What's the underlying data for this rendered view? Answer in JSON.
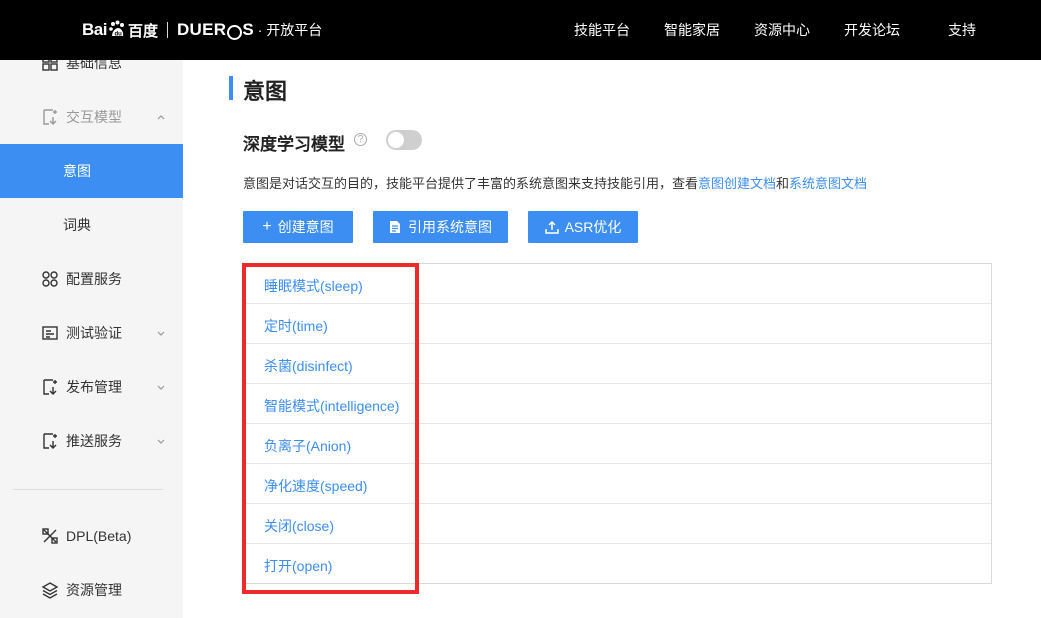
{
  "header": {
    "logo_baidu": "Bai",
    "logo_baidu_cn": "百度",
    "logo_duer": "DUER",
    "logo_os_s": "S",
    "logo_platform": "· 开放平台",
    "nav": [
      "技能平台",
      "智能家居",
      "资源中心",
      "开发论坛",
      "支持"
    ]
  },
  "sidebar": {
    "items": [
      {
        "label": "基础信息",
        "icon": "grid-icon"
      },
      {
        "label": "交互模型",
        "icon": "interaction-icon"
      },
      {
        "label": "意图"
      },
      {
        "label": "词典"
      },
      {
        "label": "配置服务",
        "icon": "config-icon"
      },
      {
        "label": "测试验证",
        "icon": "test-icon"
      },
      {
        "label": "发布管理",
        "icon": "publish-icon"
      },
      {
        "label": "推送服务",
        "icon": "push-icon"
      },
      {
        "label": "DPL(Beta)",
        "icon": "dpl-icon"
      },
      {
        "label": "资源管理",
        "icon": "layers-icon"
      }
    ]
  },
  "main": {
    "title": "意图",
    "model_label": "深度学习模型",
    "model_enabled": false,
    "help": "?",
    "description": "意图是对话交互的目的，技能平台提供了丰富的系统意图来支持技能引用，查看",
    "link1": "意图创建文档",
    "link_and": "和",
    "link2": "系统意图文档",
    "buttons": {
      "create": "创建意图",
      "system": "引用系统意图",
      "asr": "ASR优化"
    },
    "intents": [
      "睡眠模式(sleep)",
      "定时(time)",
      "杀菌(disinfect)",
      "智能模式(intelligence)",
      "负离子(Anion)",
      "净化速度(speed)",
      "关闭(close)",
      "打开(open)"
    ]
  },
  "colors": {
    "accent": "#3c8ef2",
    "highlight": "#ee2a2a",
    "topbar": "#000000",
    "sidebar": "#f5f5f5"
  }
}
